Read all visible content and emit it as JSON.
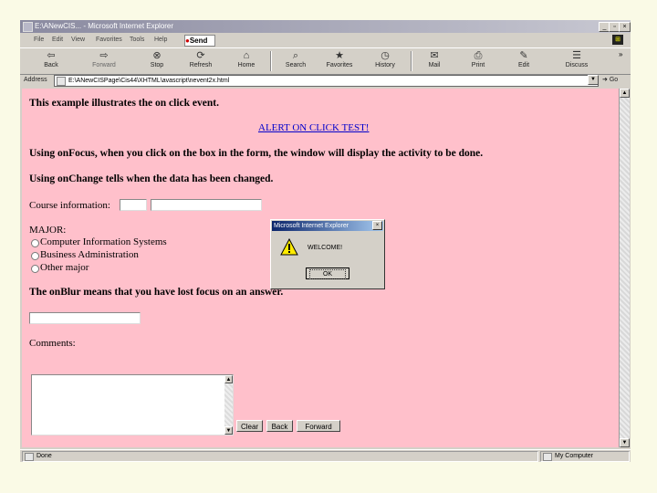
{
  "window": {
    "title": "Microsoft Internet Explorer",
    "title_prefix": "E:\\ANewCIS...",
    "buttons": [
      "_",
      "▫",
      "×"
    ]
  },
  "menu": {
    "items": [
      "File",
      "Edit",
      "View",
      "Favorites",
      "Tools",
      "Help"
    ],
    "send_label": "Send"
  },
  "toolbar": {
    "buttons": [
      {
        "label": "Back",
        "icon": "back-arrow-icon",
        "glyph": "⇦"
      },
      {
        "label": "Forward",
        "icon": "forward-arrow-icon",
        "glyph": "⇨"
      },
      {
        "label": "Stop",
        "icon": "stop-icon",
        "glyph": "⊗"
      },
      {
        "label": "Refresh",
        "icon": "refresh-icon",
        "glyph": "⟳"
      },
      {
        "label": "Home",
        "icon": "home-icon",
        "glyph": "⌂"
      },
      {
        "label": "Search",
        "icon": "search-icon",
        "glyph": "⌕"
      },
      {
        "label": "Favorites",
        "icon": "favorites-icon",
        "glyph": "★"
      },
      {
        "label": "History",
        "icon": "history-icon",
        "glyph": "◷"
      },
      {
        "label": "Mail",
        "icon": "mail-icon",
        "glyph": "✉"
      },
      {
        "label": "Print",
        "icon": "print-icon",
        "glyph": "⎙"
      },
      {
        "label": "Edit",
        "icon": "edit-icon",
        "glyph": "✎"
      },
      {
        "label": "Discuss",
        "icon": "discuss-icon",
        "glyph": "☰"
      }
    ],
    "more": "»"
  },
  "address": {
    "label": "Address",
    "value": "E:\\ANewCISPage\\Cis44\\XHTML\\avascript\\nevent2x.html",
    "go_label": "Go"
  },
  "content": {
    "intro": "This example illustrates the on click event.",
    "alert_link": "ALERT ON CLICK TEST!",
    "onfocus_text": "Using onFocus, when you click on the box in the form, the window will display the activity to be done.",
    "onchange_text": "Using onChange tells when the data has been changed.",
    "course_label": "Course information:",
    "major_label": "MAJOR:",
    "majors": [
      "Computer Information Systems",
      "Business Administration",
      "Other major"
    ],
    "onblur_text": "The onBlur means that you have lost focus on an answer.",
    "comments_label": "Comments:",
    "buttons": {
      "clear": "Clear",
      "back": "Back",
      "forward": "Forward"
    }
  },
  "dialog": {
    "title": "Microsoft Internet Explorer",
    "message": "WELCOME!",
    "ok_label": "OK"
  },
  "status": {
    "left": "Done",
    "right": "My Computer"
  }
}
